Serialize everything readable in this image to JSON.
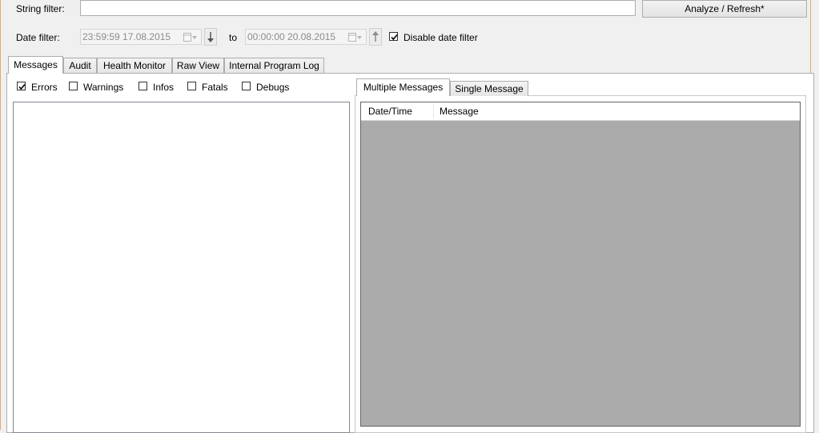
{
  "filters": {
    "string_label": "String filter:",
    "string_value": "",
    "analyze_button": "Analyze / Refresh*",
    "date_label": "Date filter:",
    "date_from": "23:59:59 17.08.2015",
    "to_label": "to",
    "date_to": "00:00:00 20.08.2015",
    "disable_date_label": "Disable date filter",
    "disable_date_checked": true
  },
  "main_tabs": [
    {
      "label": "Messages",
      "active": true
    },
    {
      "label": "Audit",
      "active": false
    },
    {
      "label": "Health Monitor",
      "active": false
    },
    {
      "label": "Raw View",
      "active": false
    },
    {
      "label": "Internal Program Log",
      "active": false
    }
  ],
  "level_filters": [
    {
      "label": "Errors",
      "checked": true
    },
    {
      "label": "Warnings",
      "checked": false
    },
    {
      "label": "Infos",
      "checked": false
    },
    {
      "label": "Fatals",
      "checked": false
    },
    {
      "label": "Debugs",
      "checked": false
    }
  ],
  "detail_tabs": [
    {
      "label": "Multiple Messages",
      "active": true
    },
    {
      "label": "Single Message",
      "active": false
    }
  ],
  "grid": {
    "columns": [
      "Date/Time",
      "Message"
    ]
  },
  "colors": {
    "window_bg": "#f0f0f0",
    "grid_bg": "#ababab",
    "frame_accent": "#e6a96f"
  }
}
